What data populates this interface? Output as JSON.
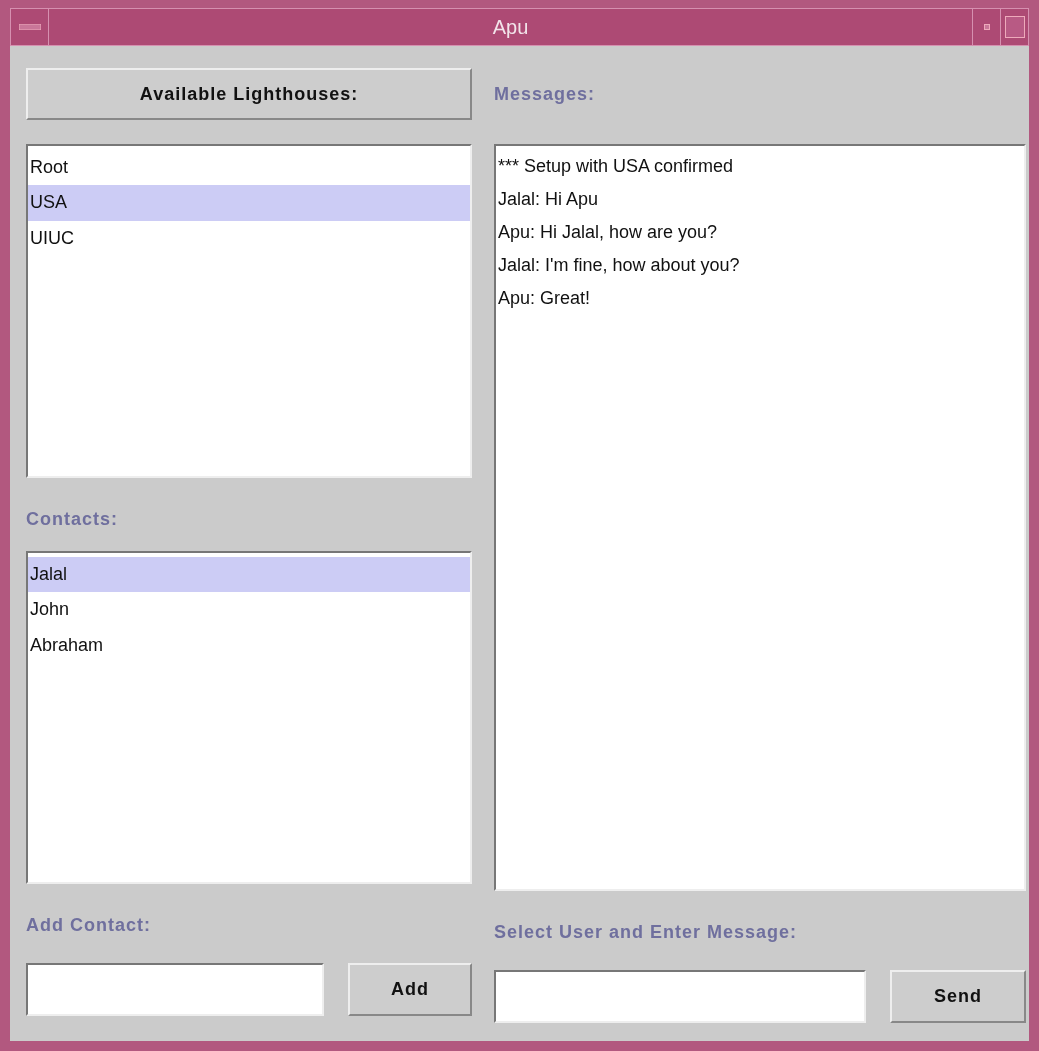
{
  "window": {
    "title": "Apu"
  },
  "lighthouses": {
    "button": "Available Lighthouses:",
    "items": [
      {
        "label": "Root",
        "selected": false
      },
      {
        "label": "USA",
        "selected": true
      },
      {
        "label": "UIUC",
        "selected": false
      }
    ]
  },
  "contacts": {
    "label": "Contacts:",
    "items": [
      {
        "label": "Jalal",
        "selected": true
      },
      {
        "label": "John",
        "selected": false
      },
      {
        "label": "Abraham",
        "selected": false
      }
    ]
  },
  "add_contact": {
    "label": "Add Contact:",
    "button": "Add"
  },
  "messages": {
    "label": "Messages:",
    "lines": [
      "*** Setup with USA confirmed",
      "Jalal: Hi Apu",
      "Apu: Hi Jalal, how are you?",
      "Jalal: I'm fine, how about you?",
      "Apu: Great!"
    ]
  },
  "send_message": {
    "label": "Select User and Enter Message:",
    "button": "Send"
  }
}
